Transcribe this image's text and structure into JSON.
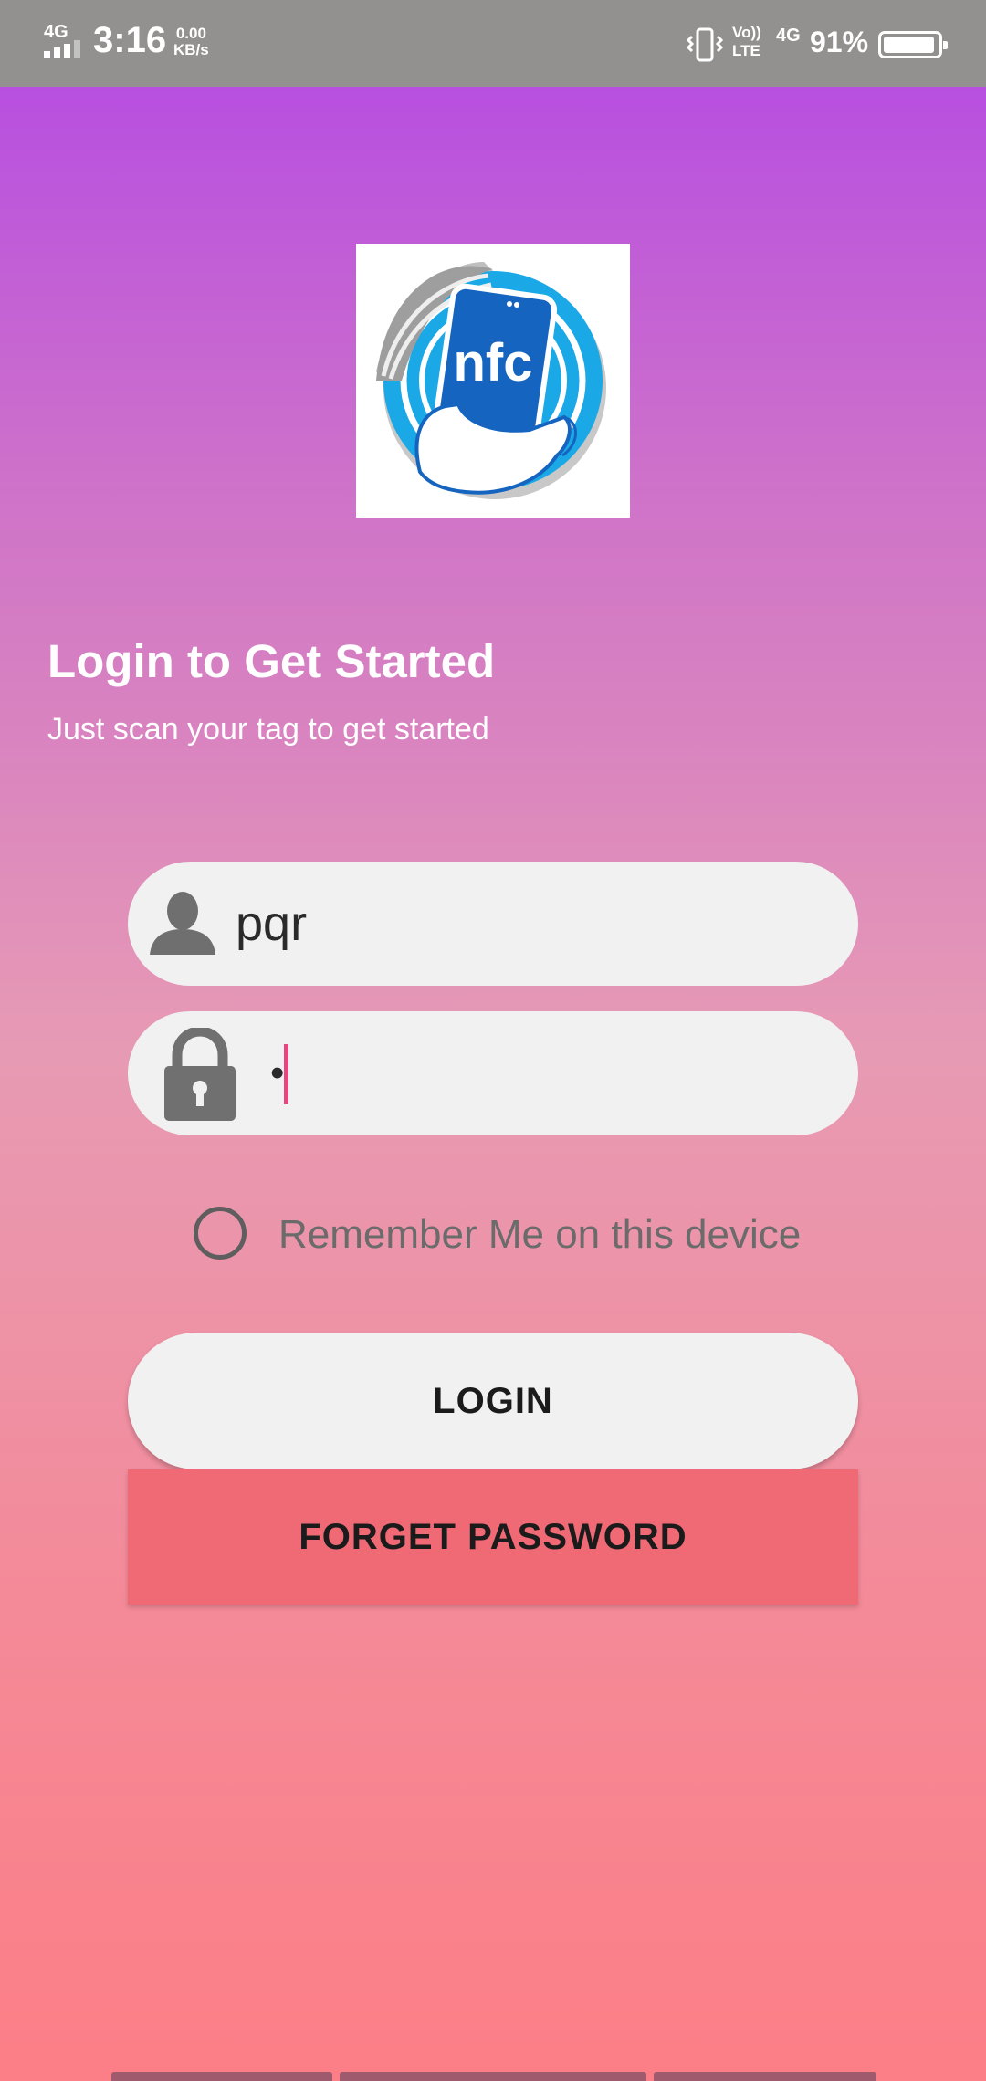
{
  "status_bar": {
    "network": "4G",
    "time": "3:16",
    "speed_value": "0.00",
    "speed_unit": "KB/s",
    "volte_top": "Vo))",
    "volte_bottom": "LTE",
    "data_type": "4G",
    "battery": "91%",
    "battery_level": 0.91
  },
  "logo": {
    "text": "nfc",
    "icon": "nfc-sticker-logo"
  },
  "header": {
    "title": "Login to Get Started",
    "subtitle": "Just scan your tag to get started"
  },
  "form": {
    "username": {
      "value": "pqr",
      "icon": "user-icon"
    },
    "password": {
      "value": "•",
      "icon": "lock-icon"
    },
    "remember_label": "Remember Me on this device",
    "remember_checked": false,
    "login_label": "LOGIN",
    "forget_label": "FORGET PASSWORD"
  },
  "colors": {
    "gradient_top": "#b84fe0",
    "gradient_bottom": "#fc7e86",
    "forget_button": "#f06a75",
    "caret": "#e4467d"
  }
}
